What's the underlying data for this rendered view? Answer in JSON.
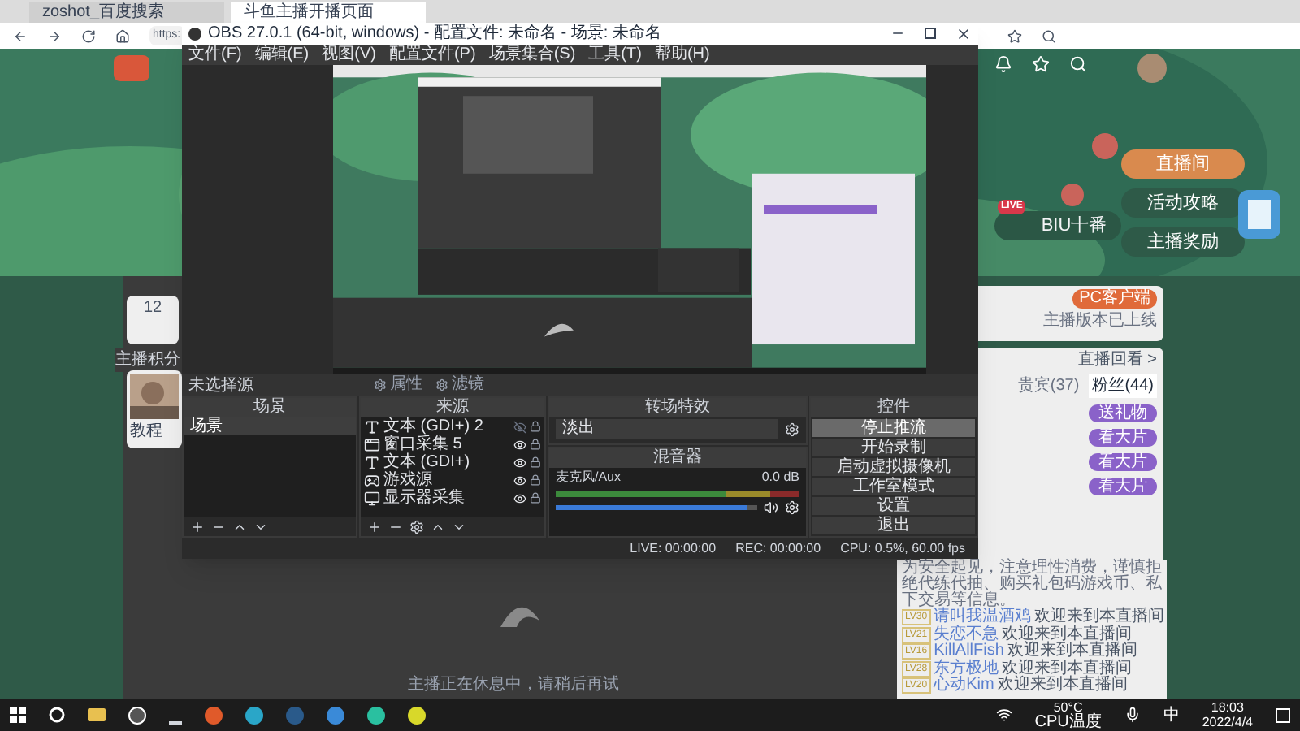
{
  "browser": {
    "tabs": [
      {
        "label": "zoshot_百度搜索",
        "selected": false
      },
      {
        "label": "斗鱼主播开播页面",
        "selected": true
      }
    ],
    "address": "https:"
  },
  "page": {
    "banner_buttons": [
      {
        "label": "直播间",
        "kind": "primary"
      },
      {
        "label": "活动攻略",
        "kind": "normal"
      },
      {
        "label": "主播奖励",
        "kind": "normal"
      }
    ],
    "nav_pill": {
      "label": "BIU十番",
      "badge": "LIVE"
    },
    "score": {
      "value": "12",
      "label": "主播积分"
    },
    "avatar_caption": "教程",
    "client_button": "PC客户端",
    "client_note": "主播版本已上线",
    "panel_links": [
      "直播回看 >"
    ],
    "panel_tabs": [
      {
        "label": "贵宾(37)",
        "selected": false
      },
      {
        "label": "粉丝(44)",
        "selected": true
      }
    ],
    "gift_buttons": [
      "送礼物",
      "看大片",
      "看大片",
      "看大片"
    ],
    "notice": "为安全起见，注意理性消费，谨慎拒绝代练代抽、购买礼包码游戏币、私下交易等信息。",
    "messages": [
      {
        "level": "LV30",
        "name": "请叫我温酒鸡",
        "text": "欢迎来到本直播间"
      },
      {
        "level": "LV21",
        "name": "失恋不急",
        "text": "欢迎来到本直播间"
      },
      {
        "level": "LV16",
        "name": "KillAllFish",
        "text": "欢迎来到本直播间"
      },
      {
        "level": "LV28",
        "name": "东方极地",
        "text": "欢迎来到本直播间"
      },
      {
        "level": "LV20",
        "name": "心动Kim",
        "text": "欢迎来到本直播间"
      }
    ],
    "offline_text": "主播正在休息中，请稍后再试"
  },
  "obs": {
    "title": "OBS 27.0.1 (64-bit, windows) - 配置文件: 未命名 - 场景: 未命名",
    "menu": [
      "文件(F)",
      "编辑(E)",
      "视图(V)",
      "配置文件(P)",
      "场景集合(S)",
      "工具(T)",
      "帮助(H)"
    ],
    "no_source": "未选择源",
    "source_buttons": [
      "属性",
      "滤镜"
    ],
    "scenes": {
      "title": "场景",
      "items": [
        {
          "label": "场景",
          "selected": true
        }
      ]
    },
    "sources": {
      "title": "来源",
      "items": [
        {
          "label": "文本 (GDI+) 2",
          "kind": "text",
          "visible": false
        },
        {
          "label": "窗口采集 5",
          "kind": "window",
          "visible": true
        },
        {
          "label": "文本 (GDI+)",
          "kind": "text",
          "visible": true
        },
        {
          "label": "游戏源",
          "kind": "game",
          "visible": true
        },
        {
          "label": "显示器采集",
          "kind": "display",
          "visible": true
        }
      ]
    },
    "transitions": {
      "title": "转场特效",
      "value": "淡出"
    },
    "mixer": {
      "title": "混音器",
      "channel": "麦克风/Aux",
      "reading": "0.0 dB",
      "level": 0.95
    },
    "controls": {
      "title": "控件",
      "items": [
        {
          "label": "停止推流",
          "active": true
        },
        {
          "label": "开始录制",
          "active": false
        },
        {
          "label": "启动虚拟摄像机",
          "active": false
        },
        {
          "label": "工作室模式",
          "active": false
        },
        {
          "label": "设置",
          "active": false
        },
        {
          "label": "退出",
          "active": false
        }
      ]
    },
    "status": {
      "live": "LIVE: 00:00:00",
      "rec": "REC: 00:00:00",
      "cpu": "CPU: 0.5%, 60.00 fps"
    }
  },
  "taskbar": {
    "temp": "50°C",
    "temp_label": "CPU温度",
    "ime": "中",
    "time": "18:03",
    "date": "2022/4/4"
  }
}
